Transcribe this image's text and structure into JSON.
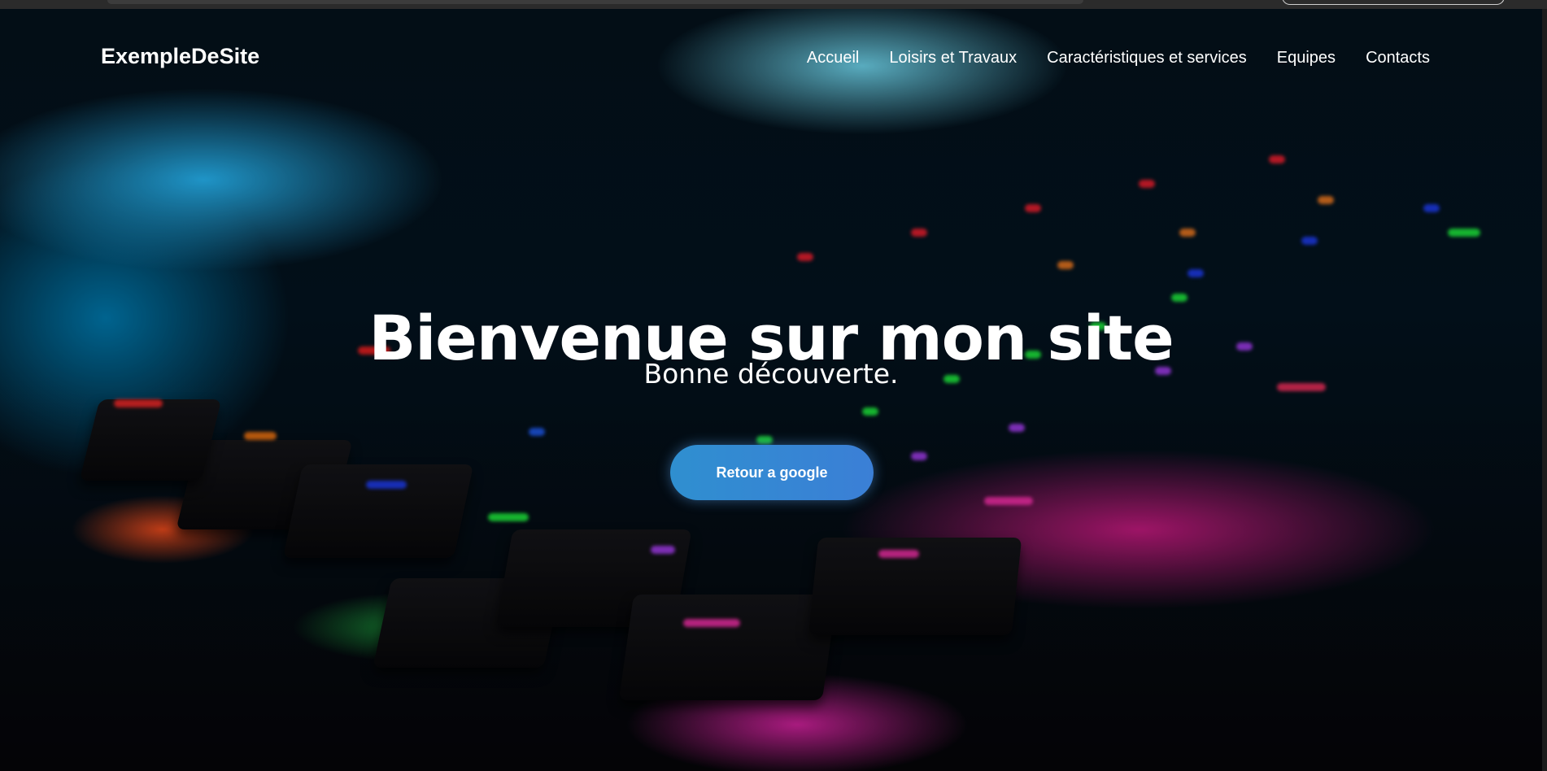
{
  "browser": {
    "tab_strip_color": "#2b2b2b"
  },
  "site": {
    "brand": "ExempleDeSite",
    "nav": [
      {
        "label": "Accueil"
      },
      {
        "label": "Loisirs et Travaux"
      },
      {
        "label": "Caractéristiques et services"
      },
      {
        "label": "Equipes"
      },
      {
        "label": "Contacts"
      }
    ]
  },
  "hero": {
    "title": "Bienvenue sur mon site",
    "subtitle": "Bonne découverte.",
    "cta_label": "Retour a google",
    "background": "rgb-keyboard-photo",
    "cta_color": "#3388d4"
  }
}
